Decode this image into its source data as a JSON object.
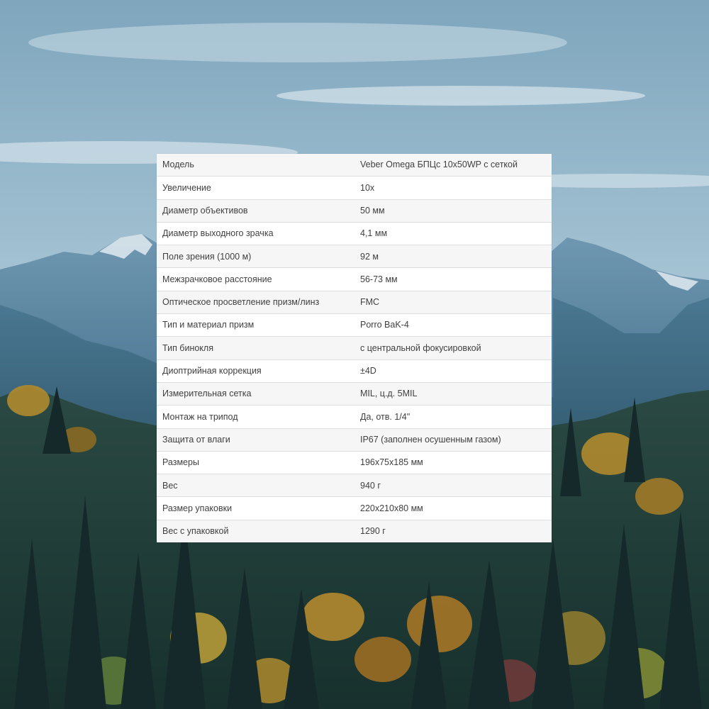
{
  "spec_table": {
    "rows": [
      {
        "name": "Модель",
        "value": "Veber Omega БПЦс 10x50WP с сеткой"
      },
      {
        "name": "Увеличение",
        "value": "10x"
      },
      {
        "name": "Диаметр объективов",
        "value": "50 мм"
      },
      {
        "name": "Диаметр выходного зрачка",
        "value": "4,1 мм"
      },
      {
        "name": "Поле зрения (1000 м)",
        "value": "92 м"
      },
      {
        "name": "Межзрачковое расстояние",
        "value": "56-73 мм"
      },
      {
        "name": "Оптическое просветление призм/линз",
        "value": "FMC"
      },
      {
        "name": "Тип и материал призм",
        "value": "Porro BaK-4"
      },
      {
        "name": "Тип бинокля",
        "value": "с центральной фокусировкой"
      },
      {
        "name": "Диоптрийная коррекция",
        "value": "±4D"
      },
      {
        "name": "Измерительная сетка",
        "value": "MIL, ц.д. 5MIL"
      },
      {
        "name": "Монтаж на трипод",
        "value": "Да, отв. 1/4\""
      },
      {
        "name": "Защита от влаги",
        "value": "IP67 (заполнен осушенным газом)"
      },
      {
        "name": "Размеры",
        "value": "196x75x185 мм"
      },
      {
        "name": "Вес",
        "value": "940 г"
      },
      {
        "name": "Размер упаковки",
        "value": "220x210x80 мм"
      },
      {
        "name": "Вес с упаковкой",
        "value": "1290 г"
      }
    ]
  },
  "colors": {
    "sky_top": "#7fa6bd",
    "sky_bottom": "#c9dde8",
    "mountain": "#5f8aa5",
    "forest_dark": "#1f3a3a",
    "foliage_autumn": "#b08a2e",
    "table_background": "#ffffff",
    "table_text": "#404040"
  }
}
